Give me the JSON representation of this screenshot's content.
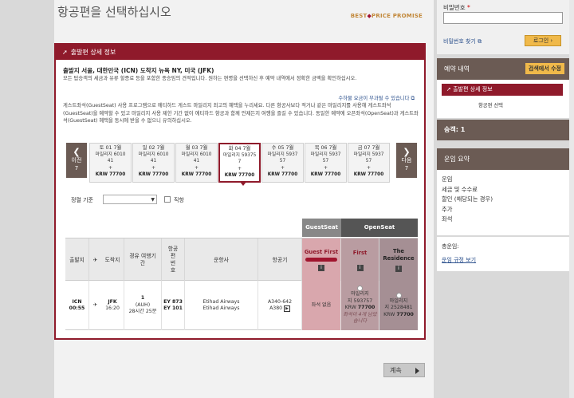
{
  "page": {
    "title": "항공편을 선택하십시오",
    "brand_a": "BEST",
    "brand_b": "PRICE PROMISE"
  },
  "panel": {
    "header": "출발편 상세 정보",
    "route": "출발지 서울, 대한민국 (ICN) 도착지 뉴욕 NY, 미국 (JFK)",
    "desc": "모든 탑승객의 세금과 유류 할증료 등을 포함한 종승임의 견적입니다. 원하는 편명을 선택하신 후 예약 내역에서 정확한 금액을 확인하십시오.",
    "fee_link": "수하물 요금이 부과될 수 있습니다",
    "desc2": "게스트좌석(GuestSeat) 사용 프로그램으로 에티하드 게스트 마일리지 최고의 혜택을 누리세요. 다른 항공사보다 적거나 같은 마일리지를 사용해 게스트좌석(GuestSeat)을 예약할 수 있고 마일리지 사용 제한 기간 없이 에티하드 항공과 함께 언제든지 여행을 즐길 수 있습니다. 동일한 예약에 오픈좌석(OpenSeat)과 게스트좌석(GuestSeat) 혜택을 동시에 받을 수 없으니 유의하십시오."
  },
  "dates": {
    "prev": {
      "label": "이전",
      "count": "7"
    },
    "next": {
      "label": "다음",
      "count": "7"
    },
    "days": [
      {
        "date": "토 01 7월",
        "line1": "마일리지 6010",
        "line2": "41",
        "line3": "+",
        "krw": "KRW 77700"
      },
      {
        "date": "일 02 7월",
        "line1": "마일리지 6010",
        "line2": "41",
        "line3": "+",
        "krw": "KRW 77700"
      },
      {
        "date": "월 03 7월",
        "line1": "마일리지 6010",
        "line2": "41",
        "line3": "+",
        "krw": "KRW 77700"
      },
      {
        "date": "화 04 7월",
        "line1": "마일리지 59375",
        "line2": "7",
        "line3": "+",
        "krw": "KRW 77700"
      },
      {
        "date": "수 05 7월",
        "line1": "마일리지 5937",
        "line2": "57",
        "line3": "+",
        "krw": "KRW 77700"
      },
      {
        "date": "목 06 7월",
        "line1": "마일리지 5937",
        "line2": "57",
        "line3": "+",
        "krw": "KRW 77700"
      },
      {
        "date": "금 07 7월",
        "line1": "마일리지 5937",
        "line2": "57",
        "line3": "+",
        "krw": "KRW 77700"
      }
    ]
  },
  "filter": {
    "sort_label": "정렬 기준",
    "direct_label": "직항"
  },
  "seat_types": {
    "guestseat": "GuestSeat",
    "openseat": "OpenSeat"
  },
  "table": {
    "headers": {
      "depart": "출발지",
      "arrive": "도착지",
      "duration": "경유 여행기간",
      "flight_no": "항공 편 번 호",
      "airline": "운항사",
      "aircraft": "항공기",
      "guest_first": "Guest First",
      "first": "First",
      "residence": "The Residence"
    },
    "row": {
      "dep_code": "ICN",
      "dep_time": "00:55",
      "arr_code": "JFK",
      "arr_time": "16:20",
      "stops": "1",
      "stop_city": "(AUH)",
      "duration": "28시간 25분",
      "flight1": "EY 873",
      "flight2": "EY 101",
      "airline1": "Etihad Airways",
      "airline2": "Etihad Airways",
      "aircraft1": "A340-642",
      "aircraft2": "A380",
      "guest_first_status": "좌석 없음",
      "first_line1": "마일리지",
      "first_line2": "지 593757",
      "first_krw_label": "KRW",
      "first_krw": "77700",
      "first_note": "좌석이 4개 남았습니다",
      "res_line1": "마일리지",
      "res_line2": "지 2528481",
      "res_krw_label": "KRW",
      "res_krw": "77700"
    }
  },
  "continue_label": "계속",
  "sidebar": {
    "pw_label": "비밀번호",
    "pw_required": "*",
    "find_pw": "비밀번호 찾기",
    "login": "로그인",
    "itinerary": "예약 내역",
    "edit_search": "검색에서 수정",
    "active_step": "출발편 상세 정보",
    "sub_step": "항공편 선택",
    "passengers": "승객: 1",
    "fare_summary": "운임 요약",
    "fare_items": [
      "운임",
      "세금 및 수수료",
      "할인 (해당되는 경우)",
      "추가",
      "좌석"
    ],
    "total_label": "총운임:",
    "fare_rules": "운임 규정 보기"
  },
  "colors": {
    "brand": "#8f1a2b",
    "accent": "#f0b94a",
    "sidebar_header": "#6b5b54"
  }
}
